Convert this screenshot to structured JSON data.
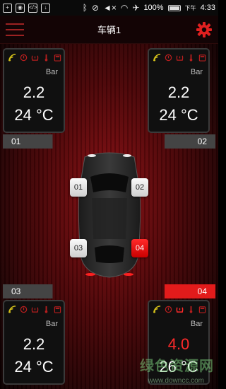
{
  "status_bar": {
    "battery": "100%",
    "time_prefix": "下午",
    "time": "4:33"
  },
  "header": {
    "title": "车辆1"
  },
  "tires": [
    {
      "id": "01",
      "pressure": "2.2",
      "temp": "24 °C",
      "unit": "Bar",
      "alert": false
    },
    {
      "id": "02",
      "pressure": "2.2",
      "temp": "24 °C",
      "unit": "Bar",
      "alert": false
    },
    {
      "id": "03",
      "pressure": "2.2",
      "temp": "24 °C",
      "unit": "Bar",
      "alert": false
    },
    {
      "id": "04",
      "pressure": "4.0",
      "temp": "26 °C",
      "unit": "Bar",
      "alert": true
    }
  ],
  "wheels": [
    "01",
    "02",
    "03",
    "04"
  ],
  "watermark": {
    "text": "绿色资源网",
    "url": "www.downcc.com"
  },
  "colors": {
    "accent": "#ff2a2a",
    "icon_yellow": "#d6c21a",
    "icon_red": "#b51e1e"
  }
}
